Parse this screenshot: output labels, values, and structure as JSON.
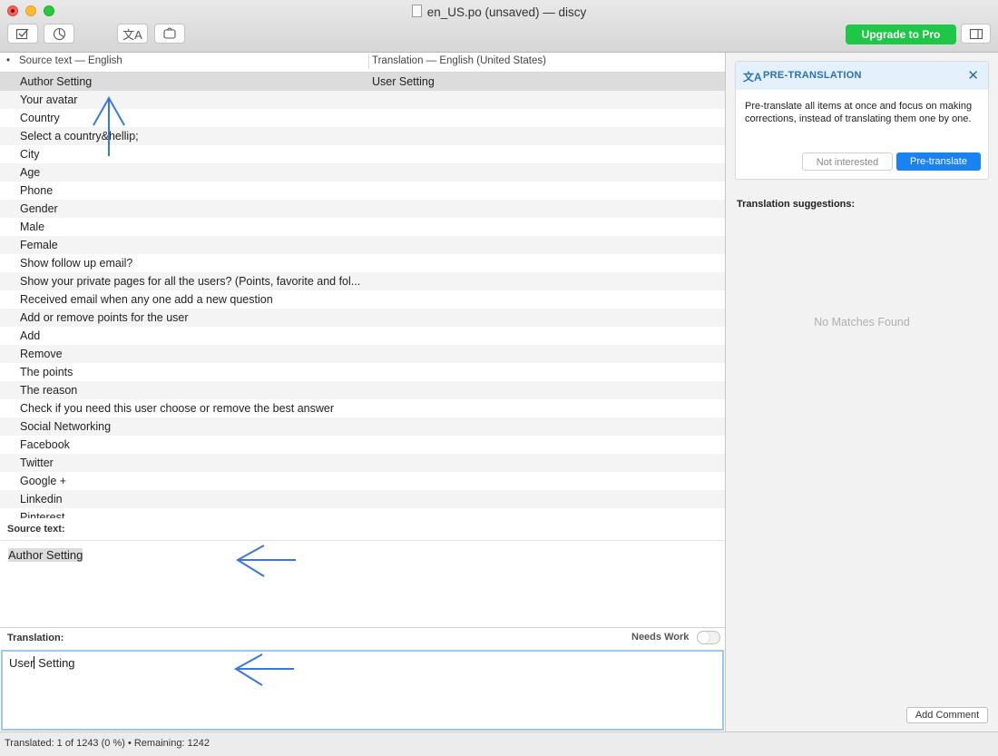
{
  "window": {
    "title": "en_US.po (unsaved) — discy"
  },
  "toolbar": {
    "icons": [
      "validate-icon",
      "statistics-icon",
      "pretranslate-icon",
      "code-icon"
    ],
    "upgrade_label": "Upgrade to Pro",
    "sidebar_toggle_icon": "sidebar-toggle-icon"
  },
  "table": {
    "header_dot": "•",
    "source_header": "Source text — English",
    "translation_header": "Translation — English (United States)",
    "rows": [
      {
        "source": "Author Setting",
        "translation": "User Setting",
        "selected": true
      },
      {
        "source": "Your avatar",
        "translation": ""
      },
      {
        "source": "Country",
        "translation": ""
      },
      {
        "source": "Select a country&hellip;",
        "translation": ""
      },
      {
        "source": "City",
        "translation": ""
      },
      {
        "source": "Age",
        "translation": ""
      },
      {
        "source": "Phone",
        "translation": ""
      },
      {
        "source": "Gender",
        "translation": ""
      },
      {
        "source": "Male",
        "translation": ""
      },
      {
        "source": "Female",
        "translation": ""
      },
      {
        "source": "Show follow up email?",
        "translation": ""
      },
      {
        "source": "Show your private pages for all the users? (Points, favorite and fol...",
        "translation": ""
      },
      {
        "source": "Received email when any one add a new question",
        "translation": ""
      },
      {
        "source": "Add or remove points for the user",
        "translation": ""
      },
      {
        "source": "Add",
        "translation": ""
      },
      {
        "source": "Remove",
        "translation": ""
      },
      {
        "source": "The points",
        "translation": ""
      },
      {
        "source": "The reason",
        "translation": ""
      },
      {
        "source": "Check if you need this user choose or remove the best answer",
        "translation": ""
      },
      {
        "source": "Social Networking",
        "translation": ""
      },
      {
        "source": "Facebook",
        "translation": ""
      },
      {
        "source": "Twitter",
        "translation": ""
      },
      {
        "source": "Google +",
        "translation": ""
      },
      {
        "source": "Linkedin",
        "translation": ""
      },
      {
        "source": "Pinterest",
        "translation": ""
      }
    ]
  },
  "editor": {
    "source_label": "Source text:",
    "source_value": "Author Setting",
    "translation_label": "Translation:",
    "needs_work_label": "Needs Work",
    "translation_value_before_caret": "User",
    "translation_value_after_caret": " Setting"
  },
  "pretranslation": {
    "title": "PRE-TRANSLATION",
    "body": "Pre-translate all items at once and focus on making corrections, instead of translating them one by one.",
    "not_interested_label": "Not interested",
    "pretranslate_label": "Pre-translate"
  },
  "sidebar": {
    "suggestions_label": "Translation suggestions:",
    "no_matches": "No Matches Found",
    "add_comment_label": "Add Comment"
  },
  "status": {
    "text": "Translated: 1 of 1243 (0 %)  •  Remaining: 1242"
  },
  "colors": {
    "upgrade": "#1ec745",
    "accent": "#1a82f1",
    "annotation_arrow": "#3a78d8"
  }
}
